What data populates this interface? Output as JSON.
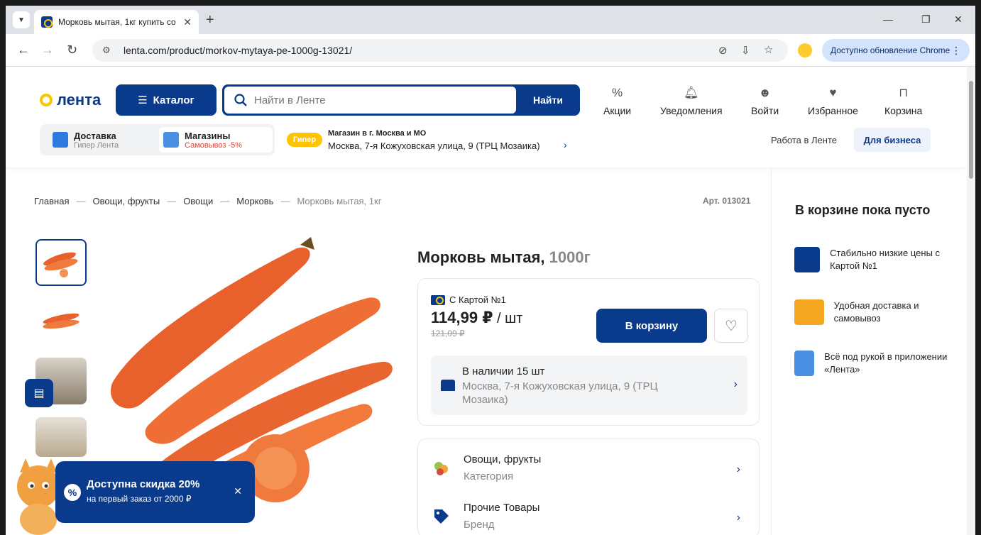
{
  "browser": {
    "tab_title": "Морковь мытая, 1кг купить со",
    "url": "lenta.com/product/morkov-mytaya-pe-1000g-13021/",
    "update_label": "Доступно обновление Chrome"
  },
  "header": {
    "logo_text": "лента",
    "catalog_label": "Каталог",
    "search_placeholder": "Найти в Ленте",
    "search_button": "Найти",
    "nav": [
      {
        "label": "Акции",
        "icon": "percent-icon"
      },
      {
        "label": "Уведомления",
        "icon": "bell-icon"
      },
      {
        "label": "Войти",
        "icon": "smile-icon"
      },
      {
        "label": "Избранное",
        "icon": "heart-icon"
      },
      {
        "label": "Корзина",
        "icon": "bag-icon"
      }
    ],
    "delivery": {
      "title": "Доставка",
      "sub": "Гипер Лента"
    },
    "stores": {
      "title": "Магазины",
      "sub": "Самовывоз -5%"
    },
    "store_badge": "Гипер",
    "store_title": "Магазин в г. Москва и МО",
    "store_address": "Москва, 7-я Кожуховская улица, 9 (ТРЦ Мозаика)",
    "work_link": "Работа в Ленте",
    "business_button": "Для бизнеса"
  },
  "breadcrumb": [
    "Главная",
    "Овощи, фрукты",
    "Овощи",
    "Морковь",
    "Морковь мытая, 1кг"
  ],
  "article": "Арт. 013021",
  "product": {
    "name": "Морковь мытая,",
    "weight": "1000г",
    "card_label": "С Картой №1",
    "price": "114,99 ₽",
    "price_unit": " / шт",
    "old_price": "121,09 ₽",
    "cart_button": "В корзину",
    "stock_title": "В наличии 15 шт",
    "stock_address": "Москва, 7-я Кожуховская улица, 9 (ТРЦ Мозаика)",
    "info": [
      {
        "title": "Овощи, фрукты",
        "sub": "Категория"
      },
      {
        "title": "Прочие Товары",
        "sub": "Бренд"
      }
    ]
  },
  "cart": {
    "empty_title": "В корзине пока пусто",
    "perks": [
      "Стабильно низкие цены с Картой №1",
      "Удобная доставка и самовывоз",
      "Всё под рукой в приложении «Лента»"
    ]
  },
  "promo": {
    "title": "Доступна скидка 20%",
    "sub": "на первый заказ от 2000 ₽"
  },
  "colors": {
    "brand": "#0a3a8c",
    "accent": "#ffc400",
    "carrot": "#e8602c"
  }
}
